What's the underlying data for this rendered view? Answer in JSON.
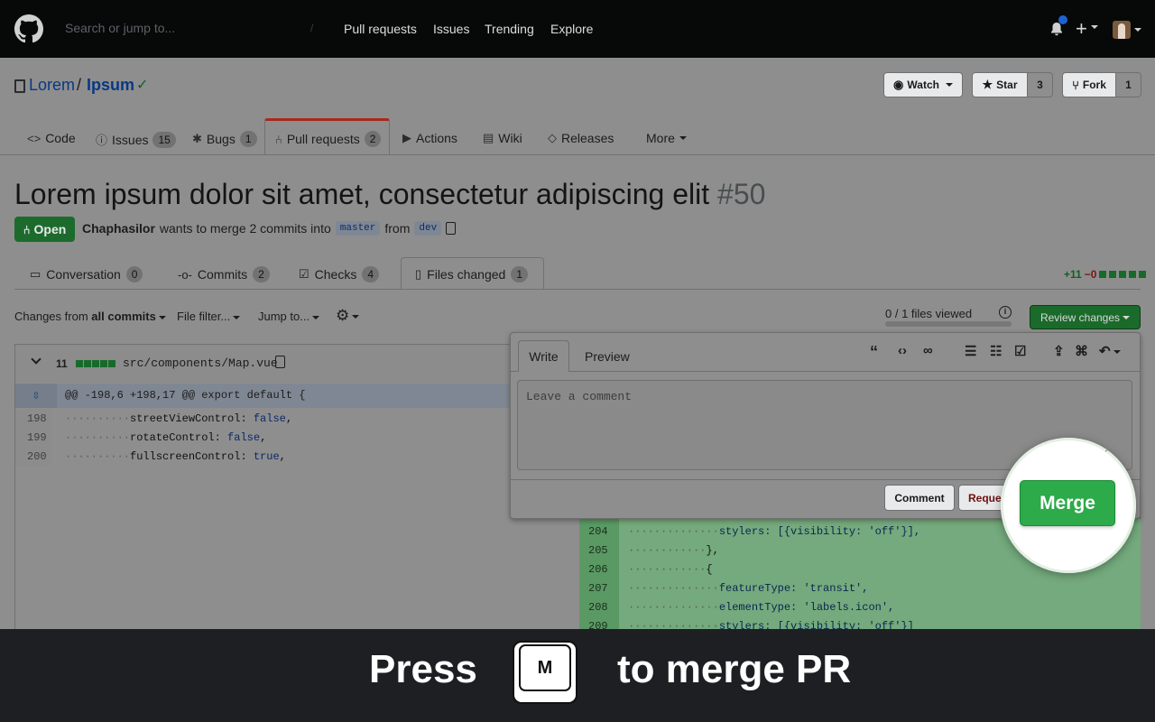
{
  "header": {
    "search_placeholder": "Search or jump to...",
    "slash_key": "/",
    "nav": [
      "Pull requests",
      "Issues",
      "Trending",
      "Explore"
    ],
    "plus": "+"
  },
  "repo": {
    "owner": "Lorem",
    "separator": "/",
    "name": "Ipsum",
    "check": "✓",
    "watch_label": "Watch",
    "star_label": "Star",
    "star_count": "3",
    "fork_label": "Fork",
    "fork_count": "1"
  },
  "repo_tabs": [
    {
      "label": "Code",
      "icon": "code-icon"
    },
    {
      "label": "Issues",
      "count": "15",
      "icon": "issue-icon"
    },
    {
      "label": "Bugs",
      "count": "1",
      "icon": "bug-icon"
    },
    {
      "label": "Pull requests",
      "count": "2",
      "icon": "pull-request-icon"
    },
    {
      "label": "Actions",
      "icon": "play-icon"
    },
    {
      "label": "Wiki",
      "icon": "book-icon"
    },
    {
      "label": "Releases",
      "icon": "tag-icon"
    },
    {
      "label": "More"
    }
  ],
  "pr": {
    "title": "Lorem ipsum dolor sit amet, consectetur adipiscing elit",
    "number": "#50",
    "state": "Open",
    "author": "Chaphasilor",
    "meta_text": "wants to merge 2 commits into",
    "base": "master",
    "from_text": "from",
    "head": "dev"
  },
  "pr_tabs": [
    {
      "label": "Conversation",
      "count": "0"
    },
    {
      "label": "Commits",
      "count": "2"
    },
    {
      "label": "Checks",
      "count": "4"
    },
    {
      "label": "Files changed",
      "count": "1"
    }
  ],
  "diffstat": {
    "additions": "+11",
    "deletions": "−0"
  },
  "toolbar": {
    "changes_prefix": "Changes from",
    "changes_bold": "all commits",
    "file_filter": "File filter...",
    "jump_to": "Jump to...",
    "files_viewed": "0 / 1 files viewed",
    "info": "i",
    "review_changes": "Review changes"
  },
  "file": {
    "count": "11",
    "path": "src/components/Map.vue",
    "hunk_header": "@@ -198,6 +198,17 @@ export default {"
  },
  "left_lines": [
    {
      "num": "198",
      "indent": "··········",
      "key": "streetViewControl",
      "value": "false"
    },
    {
      "num": "199",
      "indent": "··········",
      "key": "rotateControl",
      "value": "false"
    },
    {
      "num": "200",
      "indent": "··········",
      "key": "fullscreenControl",
      "value": "true"
    }
  ],
  "right_lines": [
    {
      "num": "204",
      "text_a": "··············",
      "text_b": "stylers: [{visibility: 'off'}],"
    },
    {
      "num": "205",
      "text_a": "············",
      "text_b": "},"
    },
    {
      "num": "206",
      "text_a": "············",
      "text_b": "{"
    },
    {
      "num": "207",
      "text_a": "··············",
      "text_b": "featureType: 'transit',"
    },
    {
      "num": "208",
      "text_a": "··············",
      "text_b": "elementType: 'labels.icon',"
    },
    {
      "num": "209",
      "text_a": "··············",
      "text_b": "stylers: [{visibility: 'off'}]"
    }
  ],
  "review_popup": {
    "write_tab": "Write",
    "preview_tab": "Preview",
    "placeholder": "Leave a comment",
    "comment_button": "Comment",
    "request_button": "Request changes",
    "tools": [
      "quote-icon",
      "code-icon",
      "link-icon",
      "bulleted-list-icon",
      "numbered-list-icon",
      "task-list-icon",
      "upload-icon",
      "mention-icon",
      "reply-icon"
    ]
  },
  "spotlight": {
    "merge_button": "Merge"
  },
  "banner": {
    "press": "Press",
    "key": "M",
    "suffix": "to merge PR"
  },
  "colors": {
    "merge_green": "#2daa4a",
    "banner_bg": "#1e1f22",
    "header_bg": "#070808"
  }
}
